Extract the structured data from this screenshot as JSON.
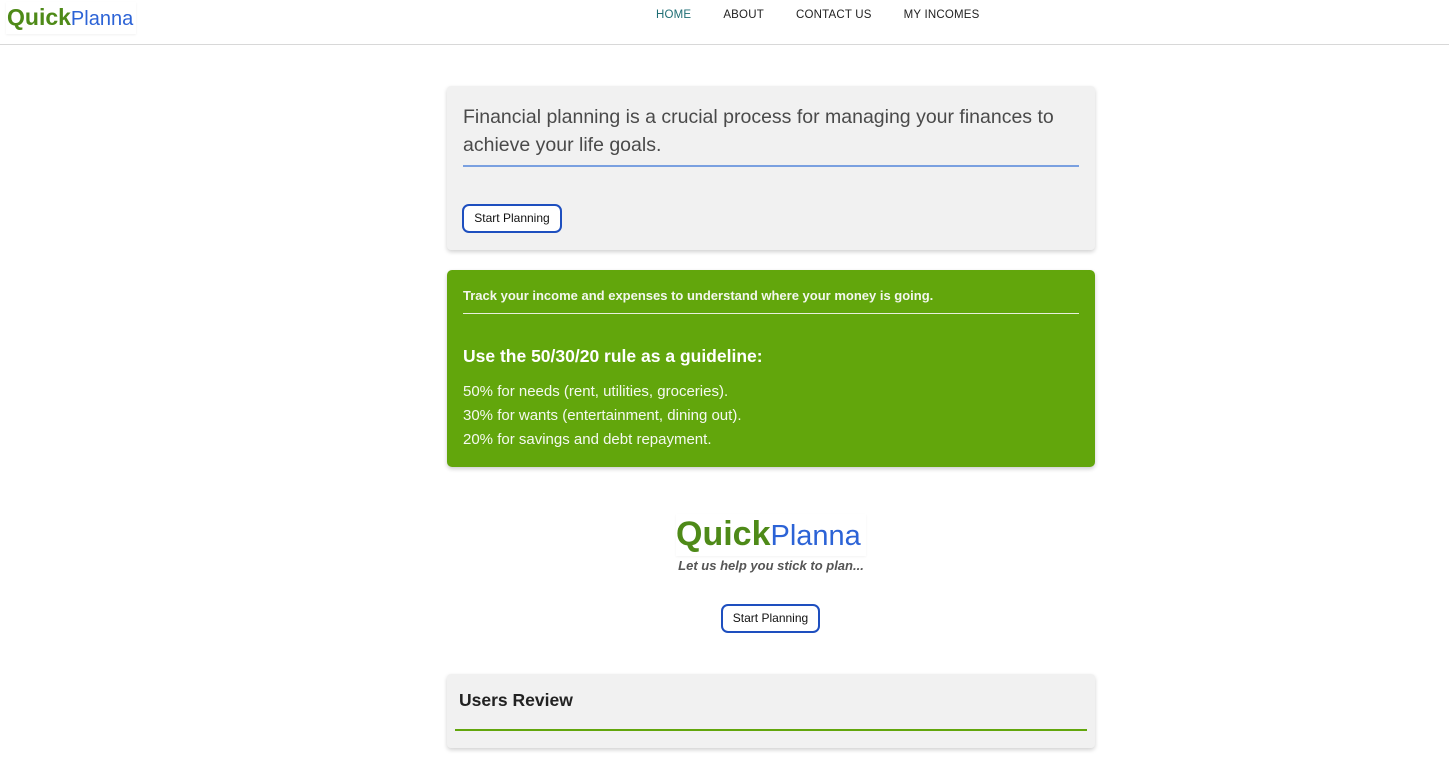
{
  "brand": {
    "quick": "Quick",
    "planna": "Planna"
  },
  "nav": {
    "items": [
      {
        "label": "HOME",
        "active": true
      },
      {
        "label": "ABOUT",
        "active": false
      },
      {
        "label": "CONTACT US",
        "active": false
      },
      {
        "label": "MY INCOMES",
        "active": false
      }
    ]
  },
  "intro": {
    "text": "Financial planning is a crucial process for managing your finances to achieve your life goals.",
    "button_label": "Start Planning"
  },
  "tips": {
    "track_text": "Track your income and expenses to understand where your money is going.",
    "rule_title": "Use the 50/30/20 rule as a guideline:",
    "items": [
      "50% for needs (rent, utilities, groceries).",
      "30% for wants (entertainment, dining out).",
      "20% for savings and debt repayment."
    ]
  },
  "hero": {
    "tagline": "Let us help you stick to plan...",
    "button_label": "Start Planning"
  },
  "reviews": {
    "title": "Users Review"
  },
  "colors": {
    "brand_green": "#4e8a18",
    "brand_blue": "#2c63d6",
    "card_green": "#62a60c",
    "nav_active": "#1f6e74"
  }
}
